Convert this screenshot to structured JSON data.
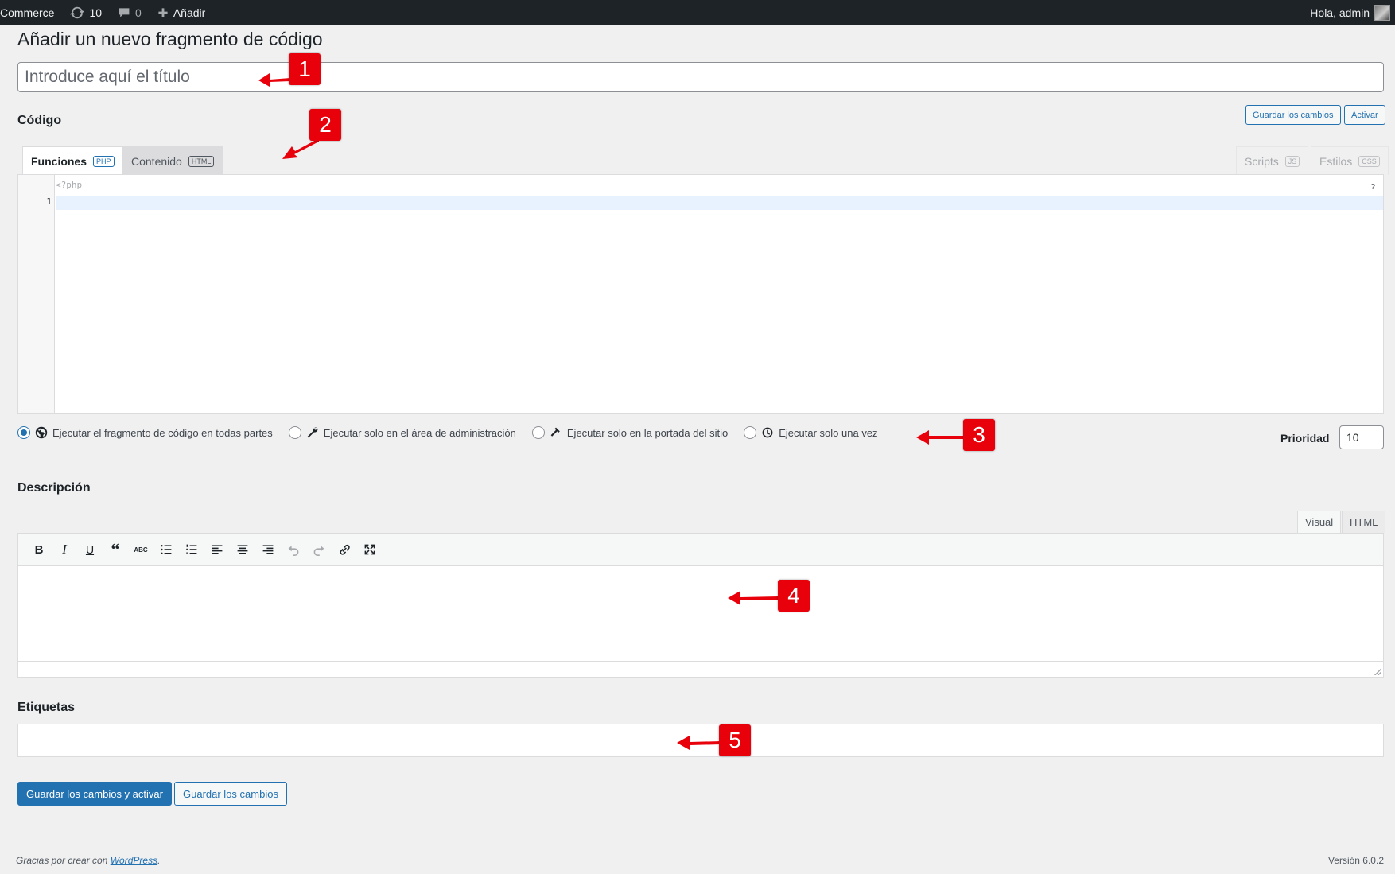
{
  "adminbar": {
    "site": "Commerce",
    "updates_count": "10",
    "comments_count": "0",
    "add_new": "Añadir",
    "greeting": "Hola, admin"
  },
  "page": {
    "title": "Añadir un nuevo fragmento de código",
    "title_placeholder": "Introduce aquí el título"
  },
  "code": {
    "heading": "Código",
    "save_button": "Guardar los cambios",
    "activate_button": "Activar",
    "tabs": [
      {
        "label": "Funciones",
        "badge": "PHP"
      },
      {
        "label": "Contenido",
        "badge": "HTML"
      },
      {
        "label": "Scripts",
        "badge": "JS"
      },
      {
        "label": "Estilos",
        "badge": "CSS"
      }
    ],
    "php_open": "<?php",
    "line_number": "1",
    "help": "?"
  },
  "scope": {
    "options": [
      {
        "label": "Ejecutar el fragmento de código en todas partes",
        "icon": "globe-icon",
        "selected": true
      },
      {
        "label": "Ejecutar solo en el área de administración",
        "icon": "wrench-icon",
        "selected": false
      },
      {
        "label": "Ejecutar solo en la portada del sitio",
        "icon": "hammer-icon",
        "selected": false
      },
      {
        "label": "Ejecutar solo una vez",
        "icon": "clock-icon",
        "selected": false
      }
    ],
    "priority_label": "Prioridad",
    "priority_value": "10"
  },
  "description": {
    "heading": "Descripción",
    "tab_visual": "Visual",
    "tab_html": "HTML"
  },
  "tags": {
    "heading": "Etiquetas"
  },
  "actions": {
    "save_activate": "Guardar los cambios y activar",
    "save": "Guardar los cambios"
  },
  "footer": {
    "thanks_prefix": "Gracias por crear con ",
    "wordpress_link": "WordPress",
    "thanks_suffix": ".",
    "version": "Versión 6.0.2"
  },
  "callouts": [
    "1",
    "2",
    "3",
    "4",
    "5"
  ],
  "colors": {
    "accent": "#2271b1",
    "callout": "#e8000b"
  }
}
